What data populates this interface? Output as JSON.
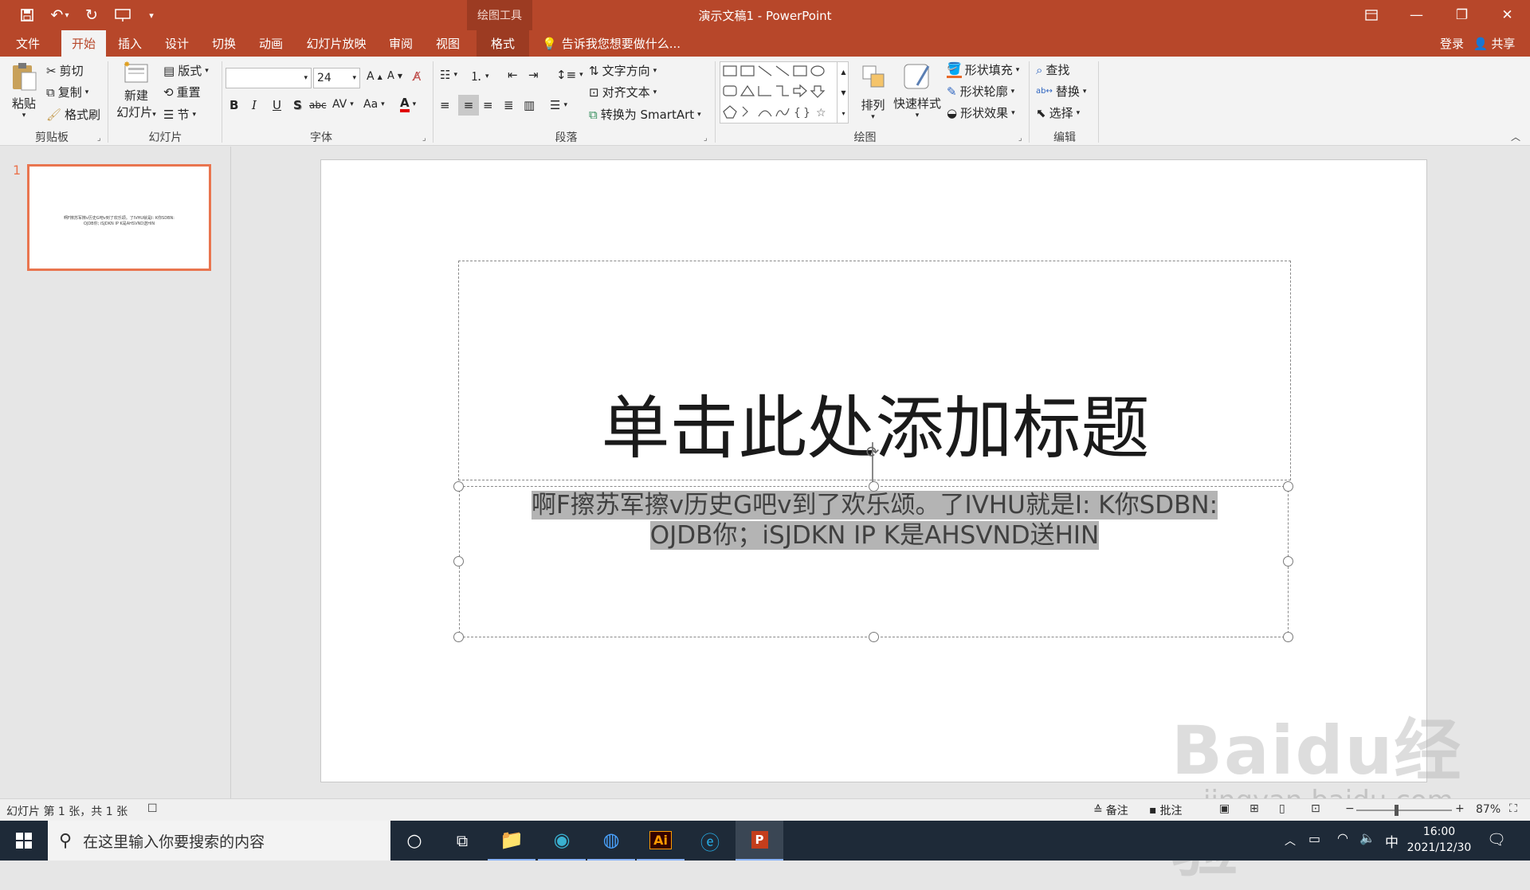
{
  "window": {
    "title": "演示文稿1 - PowerPoint",
    "contextual_tab_group": "绘图工具",
    "signin": "登录",
    "share": "共享",
    "tell_me": "告诉我您想要做什么..."
  },
  "tabs": [
    "文件",
    "开始",
    "插入",
    "设计",
    "切换",
    "动画",
    "幻灯片放映",
    "审阅",
    "视图",
    "格式"
  ],
  "ribbon": {
    "clipboard": {
      "paste": "粘贴",
      "cut": "剪切",
      "copy": "复制",
      "format_painter": "格式刷",
      "label": "剪贴板"
    },
    "slides": {
      "new_slide_1": "新建",
      "new_slide_2": "幻灯片",
      "layout": "版式",
      "reset": "重置",
      "section": "节",
      "label": "幻灯片"
    },
    "font": {
      "font_name": "",
      "font_size": "24",
      "bold": "B",
      "italic": "I",
      "underline": "U",
      "shadow": "S",
      "strike": "abc",
      "spacing": "AV",
      "case": "Aa",
      "color": "A",
      "label": "字体"
    },
    "paragraph": {
      "text_direction": "文字方向",
      "align_text": "对齐文本",
      "smartart": "转换为 SmartArt",
      "label": "段落"
    },
    "drawing": {
      "arrange": "排列",
      "quick_styles": "快速样式",
      "shape_fill": "形状填充",
      "shape_outline": "形状轮廓",
      "shape_effects": "形状效果",
      "label": "绘图"
    },
    "editing": {
      "find": "查找",
      "replace": "替换",
      "select": "选择",
      "label": "编辑"
    }
  },
  "thumbnail": {
    "number": "1",
    "line1": "啊F擦苏军擦v历史G吧v到了欢乐颂。了IVHU就是I: K你SDBN:",
    "line2": "OJDB你; iSJDKN IP K是AHSVND送HIN"
  },
  "slide": {
    "title": "单击此处添加标题",
    "body_line1": "啊F擦苏军擦v历史G吧v到了欢乐颂。了IVHU就是I:   K你SDBN:",
    "body_line2": "OJDB你；iSJDKN IP K是AHSVND送HIN"
  },
  "status": {
    "slide_info": "幻灯片 第 1 张，共 1 张",
    "notes": "备注",
    "comments": "批注",
    "zoom": "87%"
  },
  "taskbar": {
    "search_placeholder": "在这里输入你要搜索的内容",
    "ime": "中",
    "time": "16:00",
    "date": "2021/12/30"
  },
  "watermark": {
    "logo": "Baidu经验",
    "url": "jingyan.baidu.com"
  },
  "colors": {
    "accent": "#b7472a",
    "thumb_border": "#e9754f",
    "taskbar": "#1e2a38"
  }
}
